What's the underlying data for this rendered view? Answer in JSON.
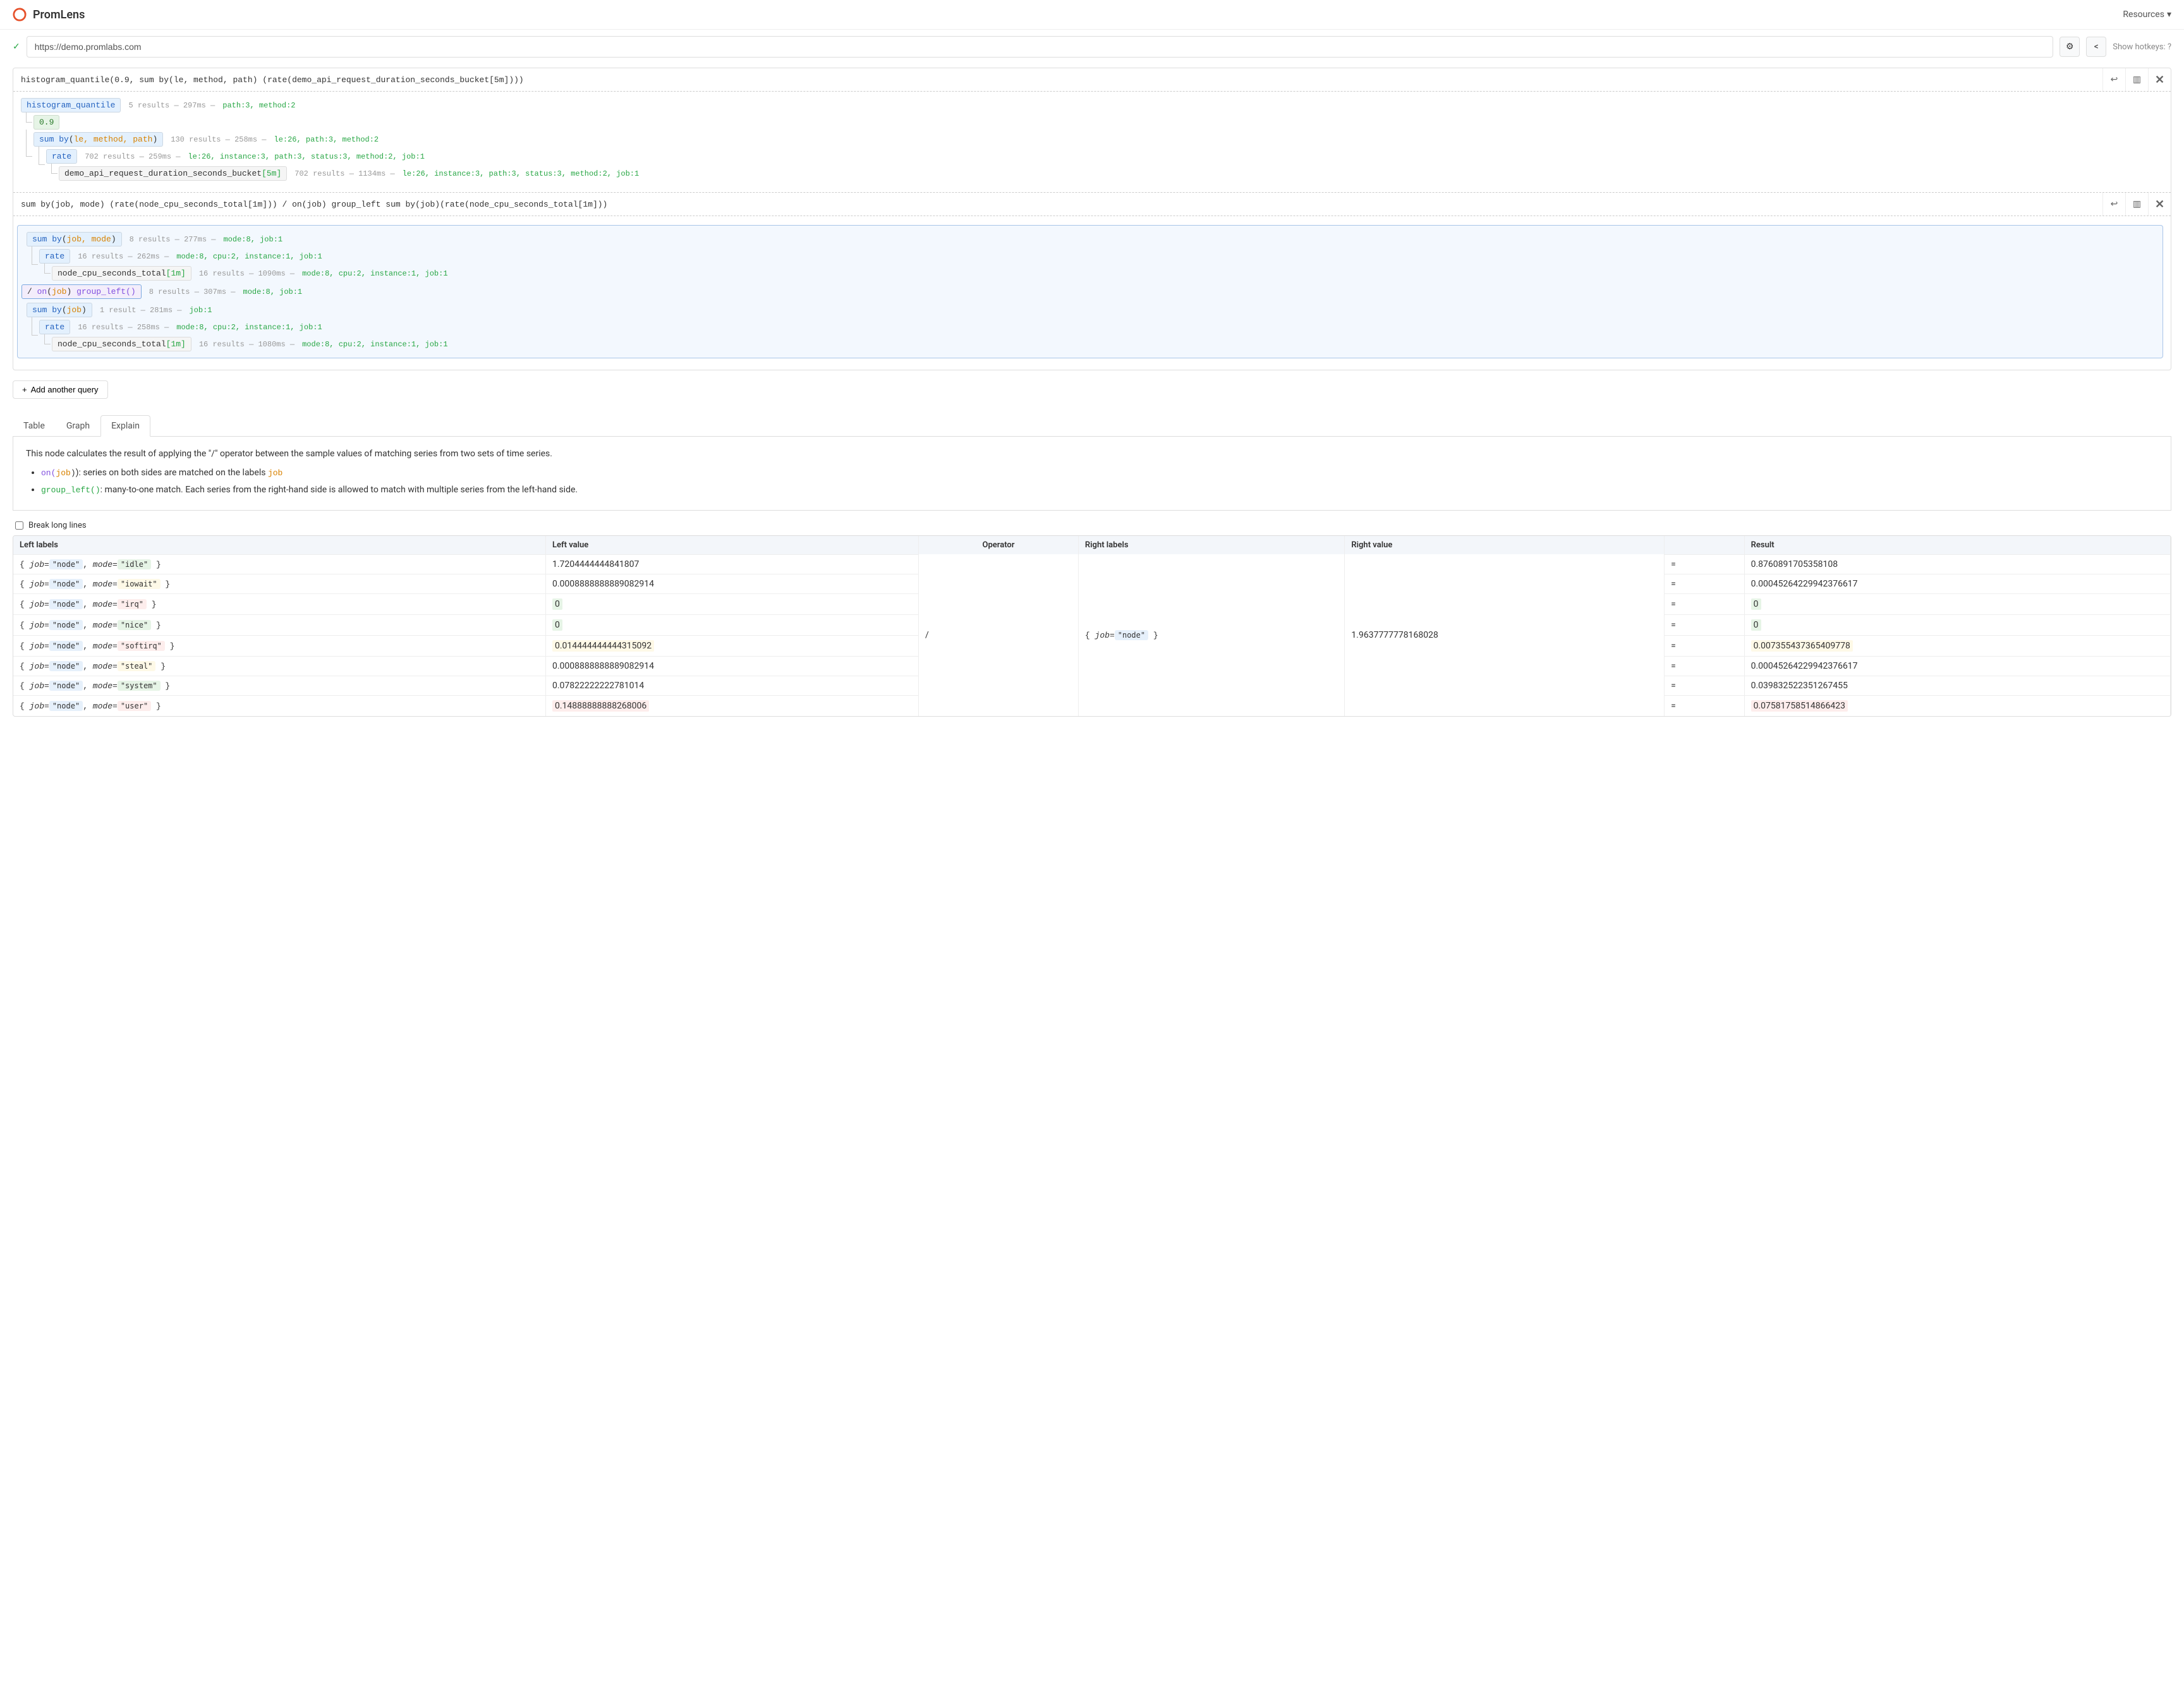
{
  "app_title": "PromLens",
  "resources_label": "Resources",
  "url": "https://demo.promlabs.com",
  "hotkeys_label": "Show hotkeys: ?",
  "query1": {
    "text": "histogram_quantile(0.9, sum by(le, method, path) (rate(demo_api_request_duration_seconds_bucket[5m])))",
    "tree": {
      "fn": "histogram_quantile",
      "fn_stats": "5 results — 297ms —",
      "fn_labels": "path:3, method:2",
      "scalar": "0.9",
      "agg_prefix": "sum by",
      "agg_labels": "le, method, path",
      "agg_stats": "130 results — 258ms —",
      "agg_kv": "le:26, path:3, method:2",
      "rate": "rate",
      "rate_stats": "702 results — 259ms —",
      "rate_kv": "le:26, instance:3, path:3, status:3, method:2, job:1",
      "metric": "demo_api_request_duration_seconds_bucket",
      "metric_range": "[5m]",
      "metric_stats": "702 results — 1134ms —",
      "metric_kv": "le:26, instance:3, path:3, status:3, method:2, job:1"
    }
  },
  "query2": {
    "text": "sum by(job, mode) (rate(node_cpu_seconds_total[1m])) / on(job) group_left sum by(job)(rate(node_cpu_seconds_total[1m]))",
    "left": {
      "agg_prefix": "sum by",
      "agg_labels": "job, mode",
      "agg_stats": "8 results — 277ms —",
      "agg_kv": "mode:8, job:1",
      "rate": "rate",
      "rate_stats": "16 results — 262ms —",
      "rate_kv": "mode:8, cpu:2, instance:1, job:1",
      "metric": "node_cpu_seconds_total",
      "metric_range": "[1m]",
      "metric_stats": "16 results — 1090ms —",
      "metric_kv": "mode:8, cpu:2, instance:1, job:1"
    },
    "op": {
      "text_op": "/",
      "text_on": "on",
      "text_job": "job",
      "text_gl": "group_left()",
      "stats": "8 results — 307ms —",
      "kv": "mode:8, job:1"
    },
    "right": {
      "agg_prefix": "sum by",
      "agg_labels": "job",
      "agg_stats": "1 result — 281ms —",
      "agg_kv": "job:1",
      "rate": "rate",
      "rate_stats": "16 results — 258ms —",
      "rate_kv": "mode:8, cpu:2, instance:1, job:1",
      "metric": "node_cpu_seconds_total",
      "metric_range": "[1m]",
      "metric_stats": "16 results — 1080ms —",
      "metric_kv": "mode:8, cpu:2, instance:1, job:1"
    }
  },
  "add_query_label": "Add another query",
  "tabs": {
    "table": "Table",
    "graph": "Graph",
    "explain": "Explain"
  },
  "explain": {
    "intro": "This node calculates the result of applying the \"/\" operator between the sample values of matching series from two sets of time series.",
    "bullet1_prefix": "on(",
    "bullet1_label": "job",
    "bullet1_suffix": "): series on both sides are matched on the labels ",
    "bullet2_prefix": "group_left()",
    "bullet2_text": ": many-to-one match. Each series from the right-hand side is allowed to match with multiple series from the left-hand side."
  },
  "break_lines_label": "Break long lines",
  "table": {
    "headers": {
      "left_labels": "Left labels",
      "left_value": "Left value",
      "operator": "Operator",
      "right_labels": "Right labels",
      "right_value": "Right value",
      "result": "Result"
    },
    "operator": "/",
    "right_label_job": "job=\"node\"",
    "right_value": "1.9637777778168028",
    "rows": [
      {
        "mode": "idle",
        "mclass": "m-idle",
        "lv": "1.7204444444841807",
        "lvclass": "",
        "res": "0.8760891705358108",
        "rclass": ""
      },
      {
        "mode": "iowait",
        "mclass": "m-iowait",
        "lv": "0.0008888888889082914",
        "lvclass": "",
        "res": "0.00045264229942376617",
        "rclass": ""
      },
      {
        "mode": "irq",
        "mclass": "m-irq",
        "lv": "0",
        "lvclass": "v-green",
        "res": "0",
        "rclass": "v-green"
      },
      {
        "mode": "nice",
        "mclass": "m-nice",
        "lv": "0",
        "lvclass": "v-green",
        "res": "0",
        "rclass": "v-green"
      },
      {
        "mode": "softirq",
        "mclass": "m-softirq",
        "lv": "0.014444444444315092",
        "lvclass": "v-yellow",
        "res": "0.007355437365409778",
        "rclass": "v-yellow"
      },
      {
        "mode": "steal",
        "mclass": "m-steal",
        "lv": "0.0008888888889082914",
        "lvclass": "",
        "res": "0.00045264229942376617",
        "rclass": ""
      },
      {
        "mode": "system",
        "mclass": "m-system",
        "lv": "0.07822222222781014",
        "lvclass": "",
        "res": "0.039832522351267455",
        "rclass": ""
      },
      {
        "mode": "user",
        "mclass": "m-user",
        "lv": "0.14888888888268006",
        "lvclass": "v-red",
        "res": "0.07581758514866423",
        "rclass": "v-red"
      }
    ]
  }
}
